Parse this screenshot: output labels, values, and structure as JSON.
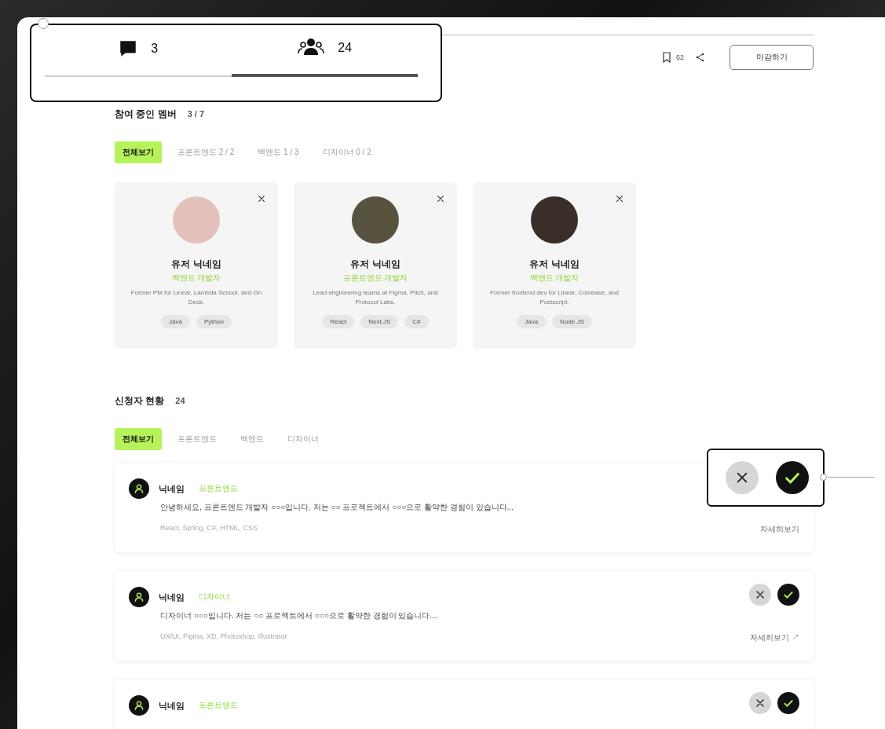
{
  "stats_tabs": [
    {
      "kind": "comments",
      "count": "3",
      "selected": false
    },
    {
      "kind": "applicants",
      "count": "24",
      "selected": true
    }
  ],
  "header": {
    "bookmark_count": "62",
    "close_button": "마감하기"
  },
  "members": {
    "title": "참여 중인 멤버",
    "count": "3 / 7",
    "filters": [
      {
        "label": "전체보기",
        "selected": true
      },
      {
        "label": "프론트엔드 2 / 2",
        "selected": false
      },
      {
        "label": "백엔드 1 / 3",
        "selected": false
      },
      {
        "label": "디자이너 0 / 2",
        "selected": false
      }
    ],
    "cards": [
      {
        "name": "유저 닉네임",
        "role": "백엔드 개발자",
        "bio": "Former PM for Linear, Lambda School, and On Deck.",
        "tags": [
          "Java",
          "Python"
        ],
        "color": "#e3c2bb"
      },
      {
        "name": "유저 닉네임",
        "role": "프론트엔드 개발자",
        "bio": "Lead engineering teams at Figma, Pitch, and Protocol Labs.",
        "tags": [
          "React",
          "Next.JS",
          "C#"
        ],
        "color": "#57533f"
      },
      {
        "name": "유저 닉네임",
        "role": "백엔드 개발자",
        "bio": "Former frontend dev for Linear, Coinbase, and Postscript.",
        "tags": [
          "Java",
          "Node.JS"
        ],
        "color": "#3a2f28"
      }
    ]
  },
  "applicants": {
    "title": "신청자 현황",
    "count": "24",
    "filters": [
      {
        "label": "전체보기",
        "selected": true
      },
      {
        "label": "프론트엔드",
        "selected": false
      },
      {
        "label": "백엔드",
        "selected": false
      },
      {
        "label": "디자이너",
        "selected": false
      }
    ],
    "rows": [
      {
        "name": "닉네임",
        "role": "프론트엔드",
        "intro": "안녕하세요, 프론트엔드 개발자 ○○○입니다. 저는 ○○ 프로젝트에서 ○○○으로 활약한 경험이 있습니다...",
        "skills": "React, Spring, C#, HTML, CSS",
        "more": "자세히보기",
        "highlighted": true
      },
      {
        "name": "닉네임",
        "role": "디자이너",
        "intro": "디자이너 ○○○입니다. 저는 ○○ 프로젝트에서 ○○○으로 활약한 경험이 있습니다...",
        "skills": "UX/UI, Figma, XD, Photoshop, Illustrator",
        "more": "자세히보기 ↗",
        "highlighted": false
      },
      {
        "name": "닉네임",
        "role": "프론트엔드",
        "highlighted": false
      }
    ]
  }
}
